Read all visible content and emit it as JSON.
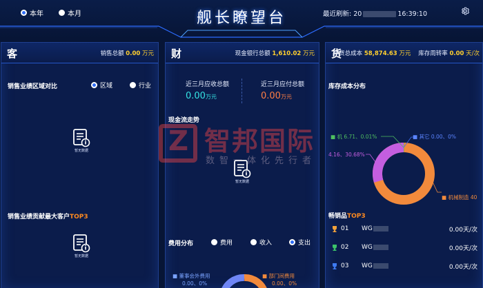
{
  "header": {
    "title": "舰长瞭望台",
    "period_options": [
      "本年",
      "本月"
    ],
    "selected_period": "本年",
    "refresh_label": "最近刷新:",
    "refresh_prefix": "20",
    "refresh_time": "16:39:10"
  },
  "customer_panel": {
    "letter": "客",
    "total_label": "销售总额",
    "total_value": "0.00",
    "total_unit": "万元",
    "region_compare_title": "销售业绩区域对比",
    "region_options": [
      "区域",
      "行业"
    ],
    "region_selected": "区域",
    "no_data_text": "暂无数据",
    "top_customers_title_a": "销售业绩贡献最大客户",
    "top_customers_title_b": "TOP3"
  },
  "finance_panel": {
    "letter": "财",
    "cash_label": "现金银行总额",
    "cash_value": "1,610.02",
    "cash_unit": "万元",
    "receivable_label": "近三月应收总额",
    "receivable_value": "0.00",
    "receivable_unit": "万元",
    "payable_label": "近三月应付总额",
    "payable_value": "0.00",
    "payable_unit": "万元",
    "cashflow_title": "现金流走势",
    "no_data_text": "暂无数据",
    "expense_title": "费用分布",
    "expense_options": [
      "费用",
      "收入",
      "支出"
    ],
    "expense_selected": "支出",
    "expense_legend": [
      {
        "label": "董事会外费用",
        "value": "0.00、0%"
      },
      {
        "label": "部门间费用",
        "value": "0.00、0%"
      }
    ]
  },
  "goods_panel": {
    "letter": "货",
    "inventory_label": "存货总成本",
    "inventory_value": "58,874.63",
    "inventory_unit": "万元",
    "turnover_label": "库存周转率",
    "turnover_value": "0.00",
    "turnover_unit": "天/次",
    "cost_dist_title": "库存成本分布",
    "pie_labels": [
      {
        "text": "机 6.71、0.01%"
      },
      {
        "text": "其它 0.00、0%"
      },
      {
        "text": "4.16、30.68%"
      },
      {
        "text": "机械制造 40"
      }
    ],
    "bestseller_title_a": "畅销品",
    "bestseller_title_b": "TOP3",
    "bestsellers": [
      {
        "rank": "01",
        "name": "WG",
        "value": "0.00天/次"
      },
      {
        "rank": "02",
        "name": "WG",
        "value": "0.00天/次"
      },
      {
        "rank": "03",
        "name": "WG",
        "value": "0.00天/次"
      }
    ]
  },
  "watermark": {
    "text": "智邦国际",
    "subtext": "数智一体化先行者"
  },
  "colors": {
    "accent_yellow": "#ffcf2e",
    "accent_cyan": "#35e3e3",
    "accent_orange": "#ff7e44",
    "pie_orange": "#f28a3c",
    "pie_purple": "#c45ee0",
    "pie_green": "#4fbf60",
    "pie_blue": "#3e6df2",
    "background": "#071536"
  }
}
